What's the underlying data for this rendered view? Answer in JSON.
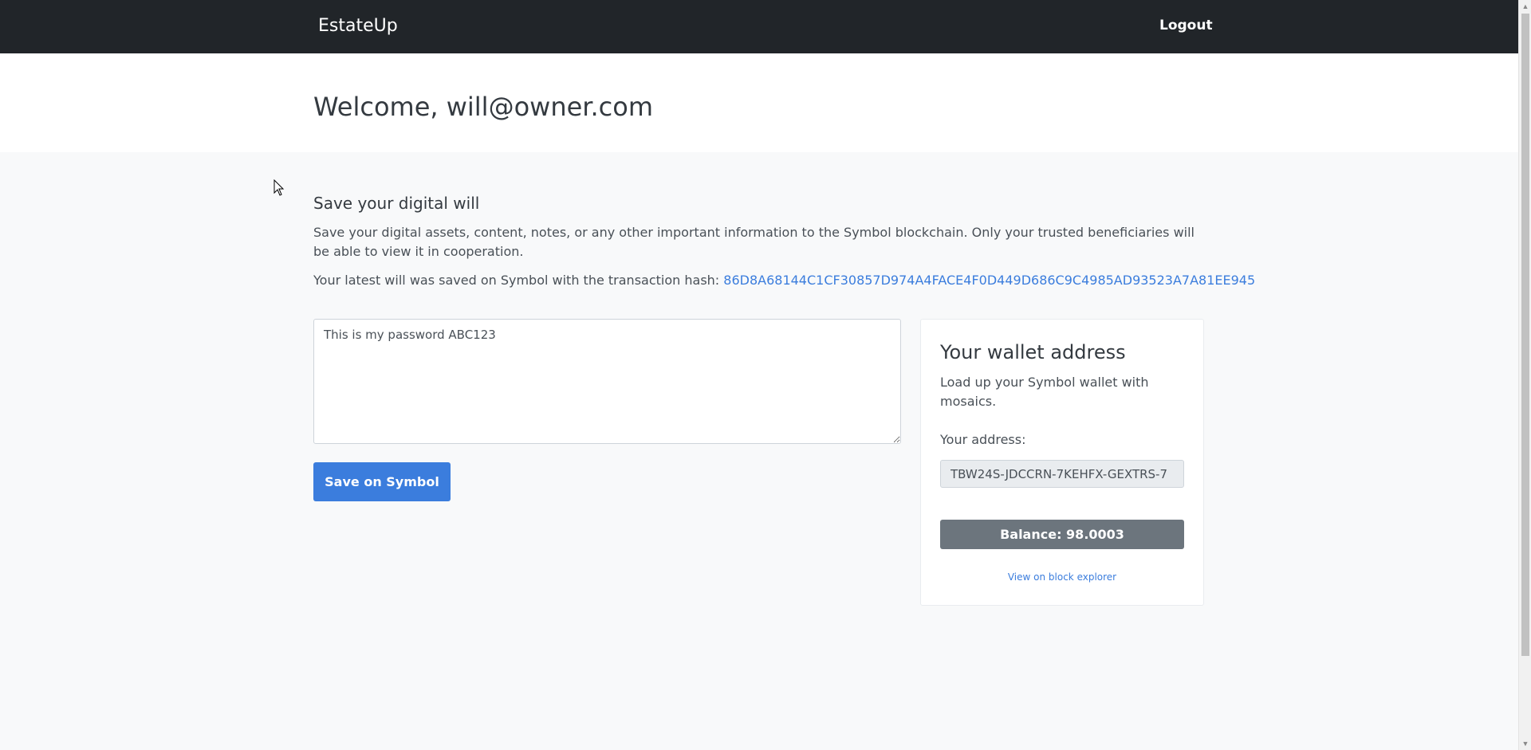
{
  "navbar": {
    "brand": "EstateUp",
    "logout_label": "Logout"
  },
  "hero": {
    "welcome": "Welcome, will@owner.com"
  },
  "main": {
    "section_title": "Save your digital will",
    "description": "Save your digital assets, content, notes, or any other important information to the Symbol blockchain. Only your trusted beneficiaries will be able to view it in cooperation.",
    "hash_prefix": "Your latest will was saved on Symbol with the transaction hash:",
    "hash_value": "86D8A68144C1CF30857D974A4FACE4F0D449D686C9C4985AD93523A7A81EE945",
    "will_text": "This is my password ABC123",
    "save_label": "Save on Symbol"
  },
  "wallet": {
    "title": "Your wallet address",
    "text": "Load up your Symbol wallet with mosaics.",
    "address_label": "Your address:",
    "address_value": "TBW24S-JDCCRN-7KEHFX-GEXTRS-7",
    "balance_label": "Balance: 98.0003",
    "explorer_label": "View on block explorer"
  },
  "colors": {
    "navbar_bg": "#212529",
    "primary": "#3b7ddd",
    "secondary": "#6c757d"
  }
}
